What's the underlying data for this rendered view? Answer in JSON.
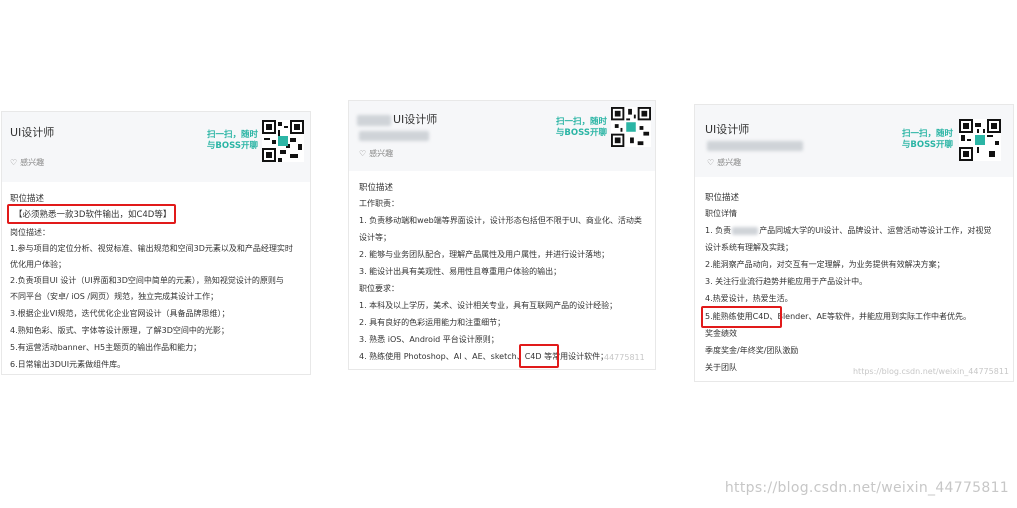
{
  "card1": {
    "title": "UI设计师",
    "interest": "感兴趣",
    "scan_line1": "扫一扫，随时",
    "scan_line2": "与BOSS开聊",
    "section": "职位描述",
    "highlight": "【必须熟悉一款3D软件输出，如C4D等】",
    "lines": [
      "岗位描述：",
      "1.参与项目的定位分析、视觉标准、输出规范和空间3D元素以及和产品经理实时",
      "优化用户体验；",
      "2.负责项目UI 设计（UI界面和3D空间中简单的元素），熟知视觉设计的原则与",
      "不同平台（安卓/ iOS /网页）规范，独立完成其设计工作；",
      "3.根据企业VI规范，迭代优化企业官网设计（具备品牌思维）；",
      "4.熟知色彩、版式、字体等设计原理，了解3D空间中的光影；",
      "5.有运营活动banner、H5主题页的输出作品和能力；",
      "6.日常输出3DUI元素做组件库。"
    ]
  },
  "card2": {
    "title": "UI设计师",
    "interest": "感兴趣",
    "scan_line1": "扫一扫，随时",
    "scan_line2": "与BOSS开聊",
    "section": "职位描述",
    "lines": [
      "工作职责：",
      "1. 负责移动端和web端等界面设计，设计形态包括但不限于UI、商业化、活动类",
      "设计等；",
      "2. 能够与业务团队配合，理解产品属性及用户属性，并进行设计落地；",
      "3. 能设计出具有美观性、易用性且尊重用户体验的输出；",
      "职位要求：",
      "1. 本科及以上学历，美术、设计相关专业，具有互联网产品的设计经验；",
      "2. 具有良好的色彩运用能力和注重细节；",
      "3. 熟悉 iOS、Android 平台设计原则；"
    ],
    "last_pre": "4. 熟练使用 Photoshop、AI 、AE、sketch、",
    "last_highlight": "C4D",
    "last_post": " 等常用设计软件；",
    "watermark": "44775811"
  },
  "card3": {
    "title": "UI设计师",
    "interest": "感兴趣",
    "scan_line1": "扫一扫，随时",
    "scan_line2": "与BOSS开聊",
    "section": "职位描述",
    "lines_top": [
      "职位详情",
      "1. 负责",
      "2.能洞察产品动向，对交互有一定理解，为业务提供有效解决方案；",
      "3. 关注行业流行趋势并能应用于产品设计中。",
      "4.热爱设计，热爱生活。"
    ],
    "line1_rest": "产品同城大学的UI设计、品牌设计、运营活动等设计工作，对视觉",
    "line1_cont": "设计系统有理解及实践；",
    "highlight": "5.能熟练使用C4D",
    "highlight_rest": "、Blender、AE等软件，并能应用到实际工作中者优先。",
    "lines_bottom": [
      "奖金绩效",
      "季度奖金/年终奖/团队激励",
      "关于团队"
    ],
    "watermark": "https://blog.csdn.net/weixin_44775811"
  },
  "page_watermark": "https://blog.csdn.net/weixin_44775811",
  "colors": {
    "accent": "#2bb5a5",
    "highlight_border": "#e11a1a",
    "header_bg": "#f6f7f9"
  }
}
